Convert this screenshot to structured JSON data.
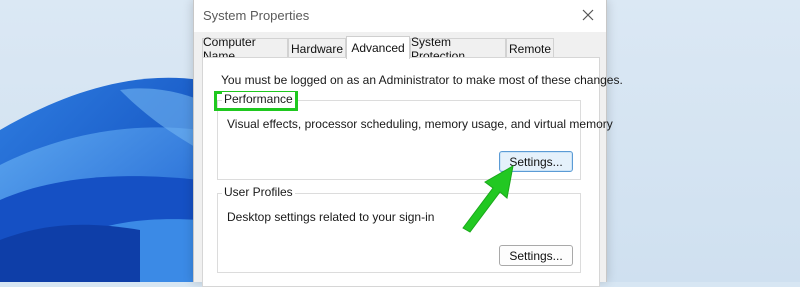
{
  "window": {
    "title": "System Properties"
  },
  "tabs": [
    {
      "label": "Computer Name",
      "active": false
    },
    {
      "label": "Hardware",
      "active": false
    },
    {
      "label": "Advanced",
      "active": true
    },
    {
      "label": "System Protection",
      "active": false
    },
    {
      "label": "Remote",
      "active": false
    }
  ],
  "advanced": {
    "admin_note": "You must be logged on as an Administrator to make most of these changes.",
    "performance": {
      "legend": "Performance",
      "description": "Visual effects, processor scheduling, memory usage, and virtual memory",
      "button_label": "Settings..."
    },
    "user_profiles": {
      "legend": "User Profiles",
      "description": "Desktop settings related to your sign-in",
      "button_label": "Settings..."
    }
  },
  "annotations": {
    "highlight_color": "#1fc81f",
    "arrow_color": "#22c822"
  },
  "icons": {
    "close": "close-icon"
  }
}
